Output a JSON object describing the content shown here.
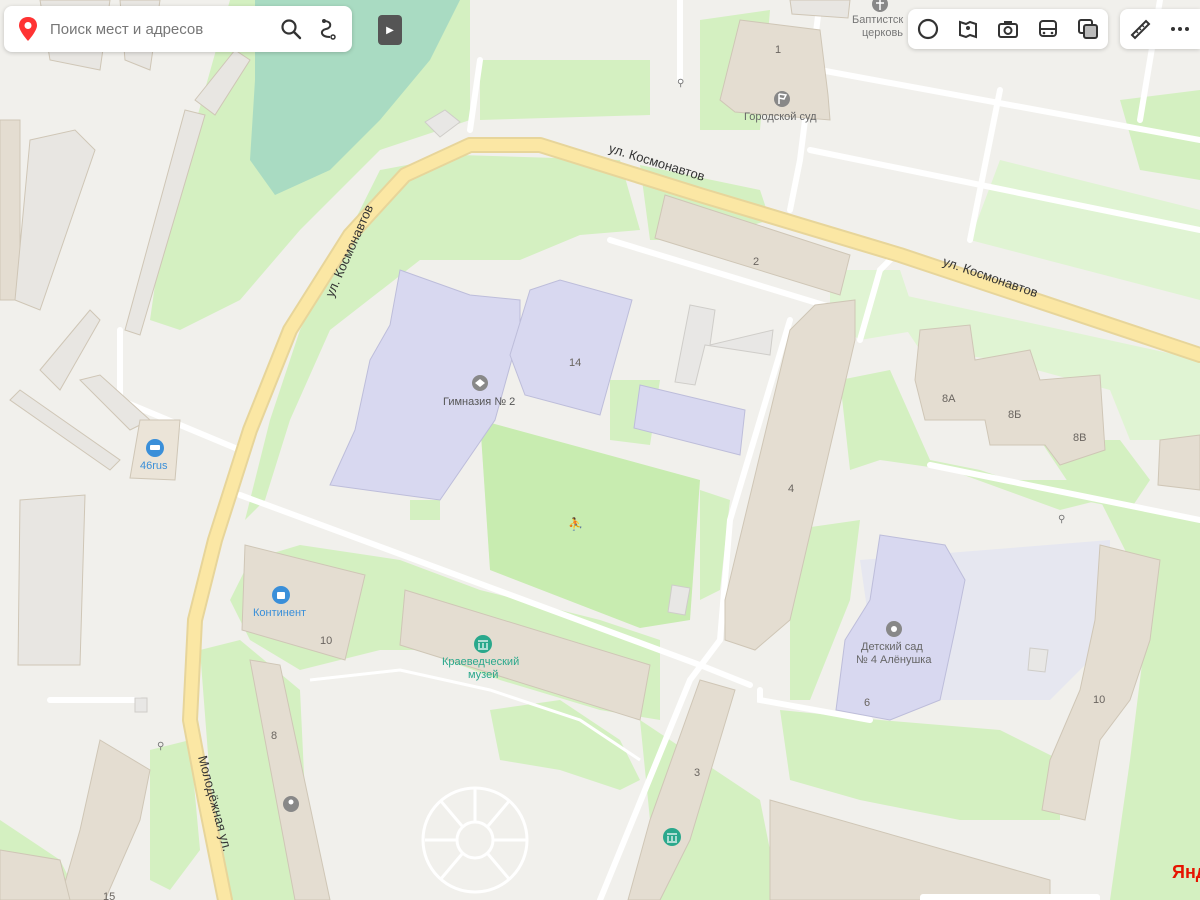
{
  "search": {
    "placeholder": "Поиск мест и адресов"
  },
  "toolbar": {
    "icons": [
      "layers-circle-icon",
      "panorama-icon",
      "camera-icon",
      "bus-icon",
      "map-layers-icon"
    ],
    "ruler_icon": "ruler-icon",
    "more_icon": "more-icon"
  },
  "streets": {
    "kosmonavtov_top": "ул. Космонавтов",
    "kosmonavtov_right": "ул. Космонавтов",
    "kosmonavtov_vertical": "ул. Космонавтов",
    "molodezhnaya": "Молодёжная ул."
  },
  "pois": {
    "baptist": "Баптистская церковь",
    "baptist_line1": "Баптистск",
    "baptist_line2": "церковь",
    "court": "Городской суд",
    "gymnasium": "Гимназия № 2",
    "car_service": "46rus",
    "continent": "Континент",
    "museum_line1": "Краеведческий",
    "museum_line2": "музей",
    "kindergarten_line1": "Детский сад",
    "kindergarten_line2": "№ 4 Алёнушка"
  },
  "house_numbers": {
    "h1": "1",
    "h2": "2",
    "h14": "14",
    "h8a": "8А",
    "h8b": "8Б",
    "h8v": "8В",
    "h4": "4",
    "h10a": "10",
    "h10b": "10",
    "h6": "6",
    "h8": "8",
    "h3": "3",
    "h15": "15"
  },
  "brand": "Янд",
  "colors": {
    "background": "#f1f0ec",
    "park": "#d4f0c1",
    "water": "#a9dbc2",
    "road_yellow": "#fbe7a4",
    "building_residential": "#e4ddd1",
    "building_public": "#d8d8f0",
    "poi_blue": "#3a8fd9",
    "poi_teal": "#2aa88c",
    "poi_gray": "#888888",
    "brand_red": "#e61400"
  }
}
